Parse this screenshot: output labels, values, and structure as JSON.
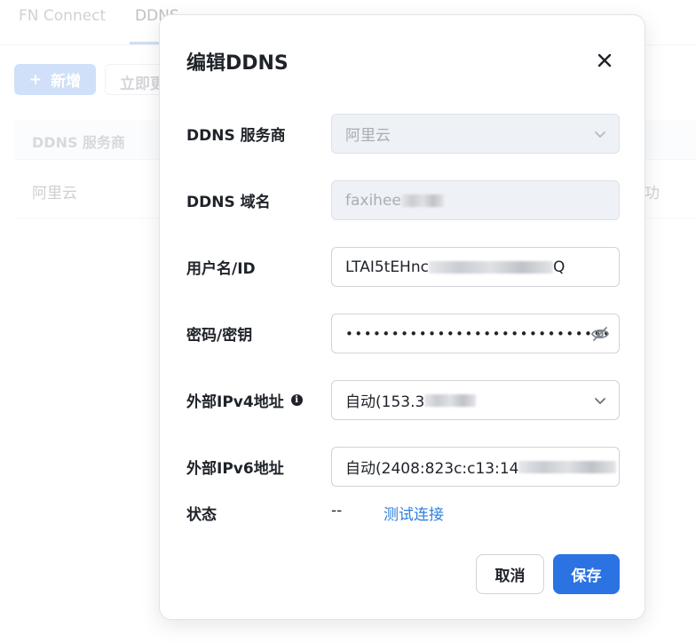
{
  "background": {
    "tabs": [
      {
        "label": "FN Connect",
        "active": false
      },
      {
        "label": "DDNS",
        "active": true
      }
    ],
    "add_button_label": "新增",
    "second_button_label": "立即更",
    "table_header": "DDNS 服务商",
    "row_provider": "阿里云",
    "row_status_partial": "功"
  },
  "modal": {
    "title": "编辑DDNS",
    "fields": {
      "provider": {
        "label": "DDNS 服务商",
        "value": "阿里云"
      },
      "domain": {
        "label": "DDNS 域名",
        "value": "faxihee"
      },
      "username": {
        "label": "用户名/ID",
        "value_prefix": "LTAI5tEHnc",
        "value_suffix": "Q"
      },
      "password": {
        "label": "密码/密钥",
        "value": "•••••••••••••••••••••••••••••"
      },
      "ipv4": {
        "label": "外部IPv4地址",
        "value": "自动(153.3"
      },
      "ipv6": {
        "label": "外部IPv6地址",
        "value": "自动(2408:823c:c13:14"
      }
    },
    "status": {
      "label": "状态",
      "value": "--",
      "test_link": "测试连接"
    },
    "cancel_label": "取消",
    "save_label": "保存"
  },
  "colors": {
    "primary": "#2b73e3",
    "link": "#2f7fdb",
    "disabled_bg": "#eef1f5"
  }
}
